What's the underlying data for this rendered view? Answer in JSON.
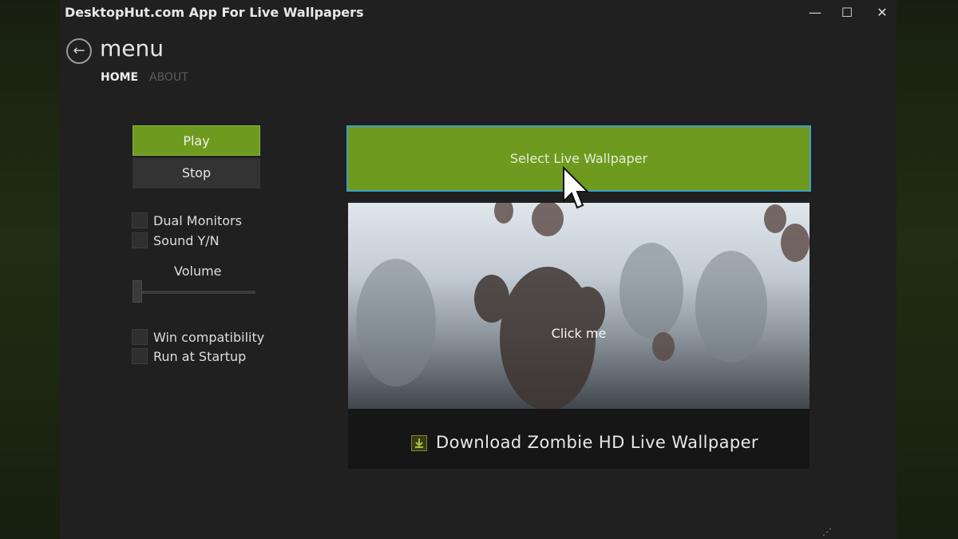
{
  "window": {
    "title": "DesktopHut.com App For Live Wallpapers",
    "controls": {
      "minimize": "—",
      "maximize": "☐",
      "close": "✕"
    }
  },
  "header": {
    "back_glyph": "←",
    "title": "menu",
    "tabs": [
      {
        "label": "HOME",
        "active": true
      },
      {
        "label": "ABOUT",
        "active": false
      }
    ]
  },
  "controls": {
    "play_label": "Play",
    "stop_label": "Stop",
    "checkboxes": [
      {
        "label": "Dual Monitors",
        "checked": false
      },
      {
        "label": "Sound Y/N",
        "checked": false
      },
      {
        "label": "Win compatibility",
        "checked": false
      },
      {
        "label": "Run at Startup",
        "checked": false
      }
    ],
    "volume_label": "Volume",
    "volume_level": 0
  },
  "main": {
    "select_label": "Select Live Wallpaper",
    "preview_label": "Click me",
    "download_label": "Download Zombie HD Live Wallpaper"
  },
  "colors": {
    "accent_green": "#6e9b1f",
    "focus_border": "#3da0c4",
    "window_bg": "#202020"
  },
  "icons": {
    "back": "back-arrow-icon",
    "download": "download-icon",
    "cursor": "mouse-cursor-icon"
  }
}
